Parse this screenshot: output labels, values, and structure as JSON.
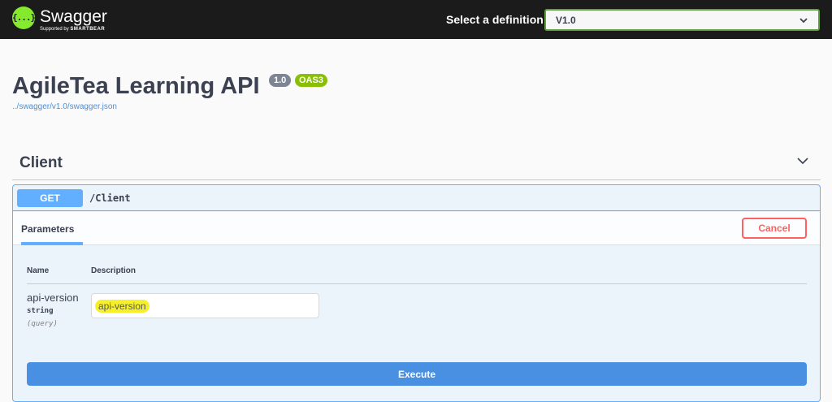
{
  "topbar": {
    "logo_glyph": "{...}",
    "logo_title": "Swagger",
    "logo_subtitle_prefix": "Supported by",
    "logo_subtitle_brand": "SMARTBEAR",
    "definition_label": "Select a definition",
    "definition_value": "V1.0",
    "dropdown_icon": "chevron-down-icon",
    "logo_color": "#85ea2d",
    "select_border_color": "#62a03f"
  },
  "info": {
    "title": "AgileTea Learning API",
    "version_badge": "1.0",
    "oas_badge": "OAS3",
    "spec_link": "../swagger/v1.0/swagger.json",
    "version_badge_color": "#7d8492",
    "oas_badge_color": "#89bf04"
  },
  "tag": {
    "name": "Client",
    "toggle_icon": "chevron-down-icon"
  },
  "operation": {
    "method": "GET",
    "path": "/Client",
    "method_color": "#61affe",
    "tab_label": "Parameters",
    "cancel_label": "Cancel",
    "cancel_color": "#ff6060",
    "columns": {
      "name": "Name",
      "description": "Description"
    },
    "parameter": {
      "name": "api-version",
      "type": "string",
      "location": "(query)",
      "input_value": "api-version"
    },
    "execute_label": "Execute",
    "execute_color": "#4990e2"
  }
}
